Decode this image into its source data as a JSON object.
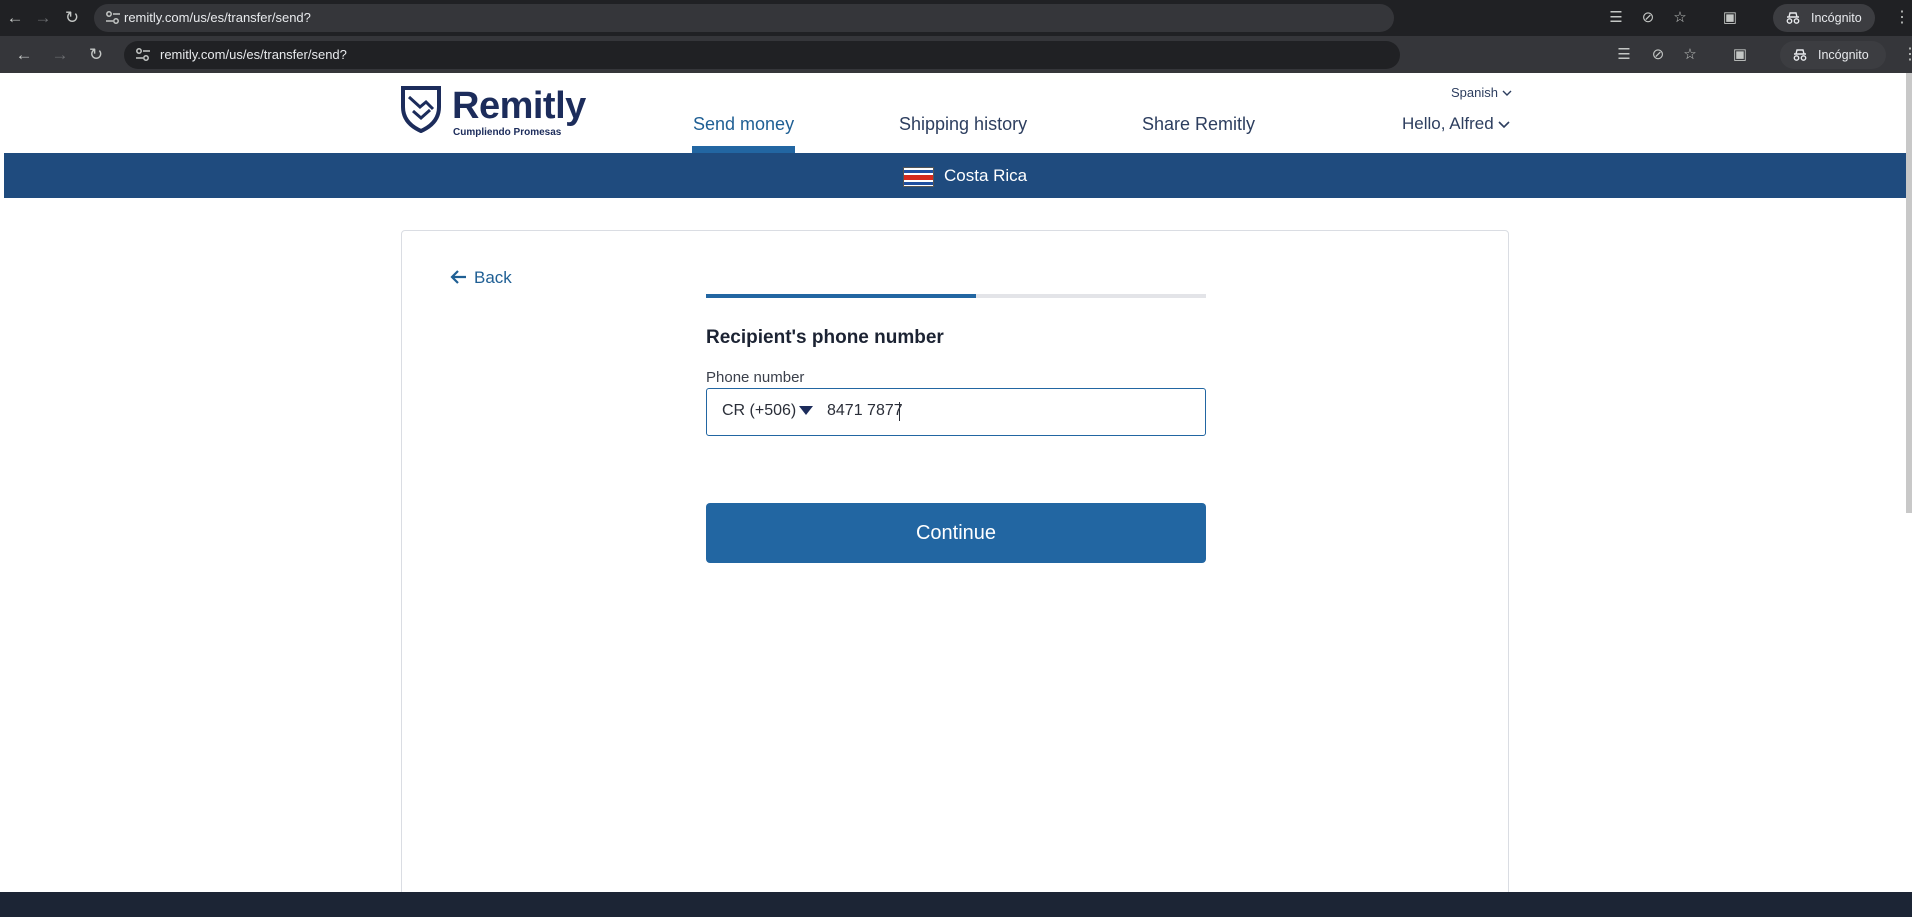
{
  "browser": {
    "url": "remitly.com/us/es/transfer/send?",
    "incognito_label": "Incógnito"
  },
  "site": {
    "logo_text": "Remitly",
    "logo_tagline": "Cumpliendo Promesas",
    "nav": {
      "send_money": "Send money",
      "shipping_history": "Shipping history",
      "share": "Share Remitly"
    },
    "language": "Spanish",
    "greeting": "Hello, Alfred",
    "country": "Costa Rica"
  },
  "form": {
    "back_label": "Back",
    "progress_fraction": 0.54,
    "title": "Recipient's phone number",
    "phone_label": "Phone number",
    "country_code": "CR (+506)",
    "phone_value": "8471 7877",
    "continue_label": "Continue"
  },
  "colors": {
    "brand_navy": "#1c2c5b",
    "accent_blue": "#2266a2",
    "banner_blue": "#1f4b7e"
  }
}
